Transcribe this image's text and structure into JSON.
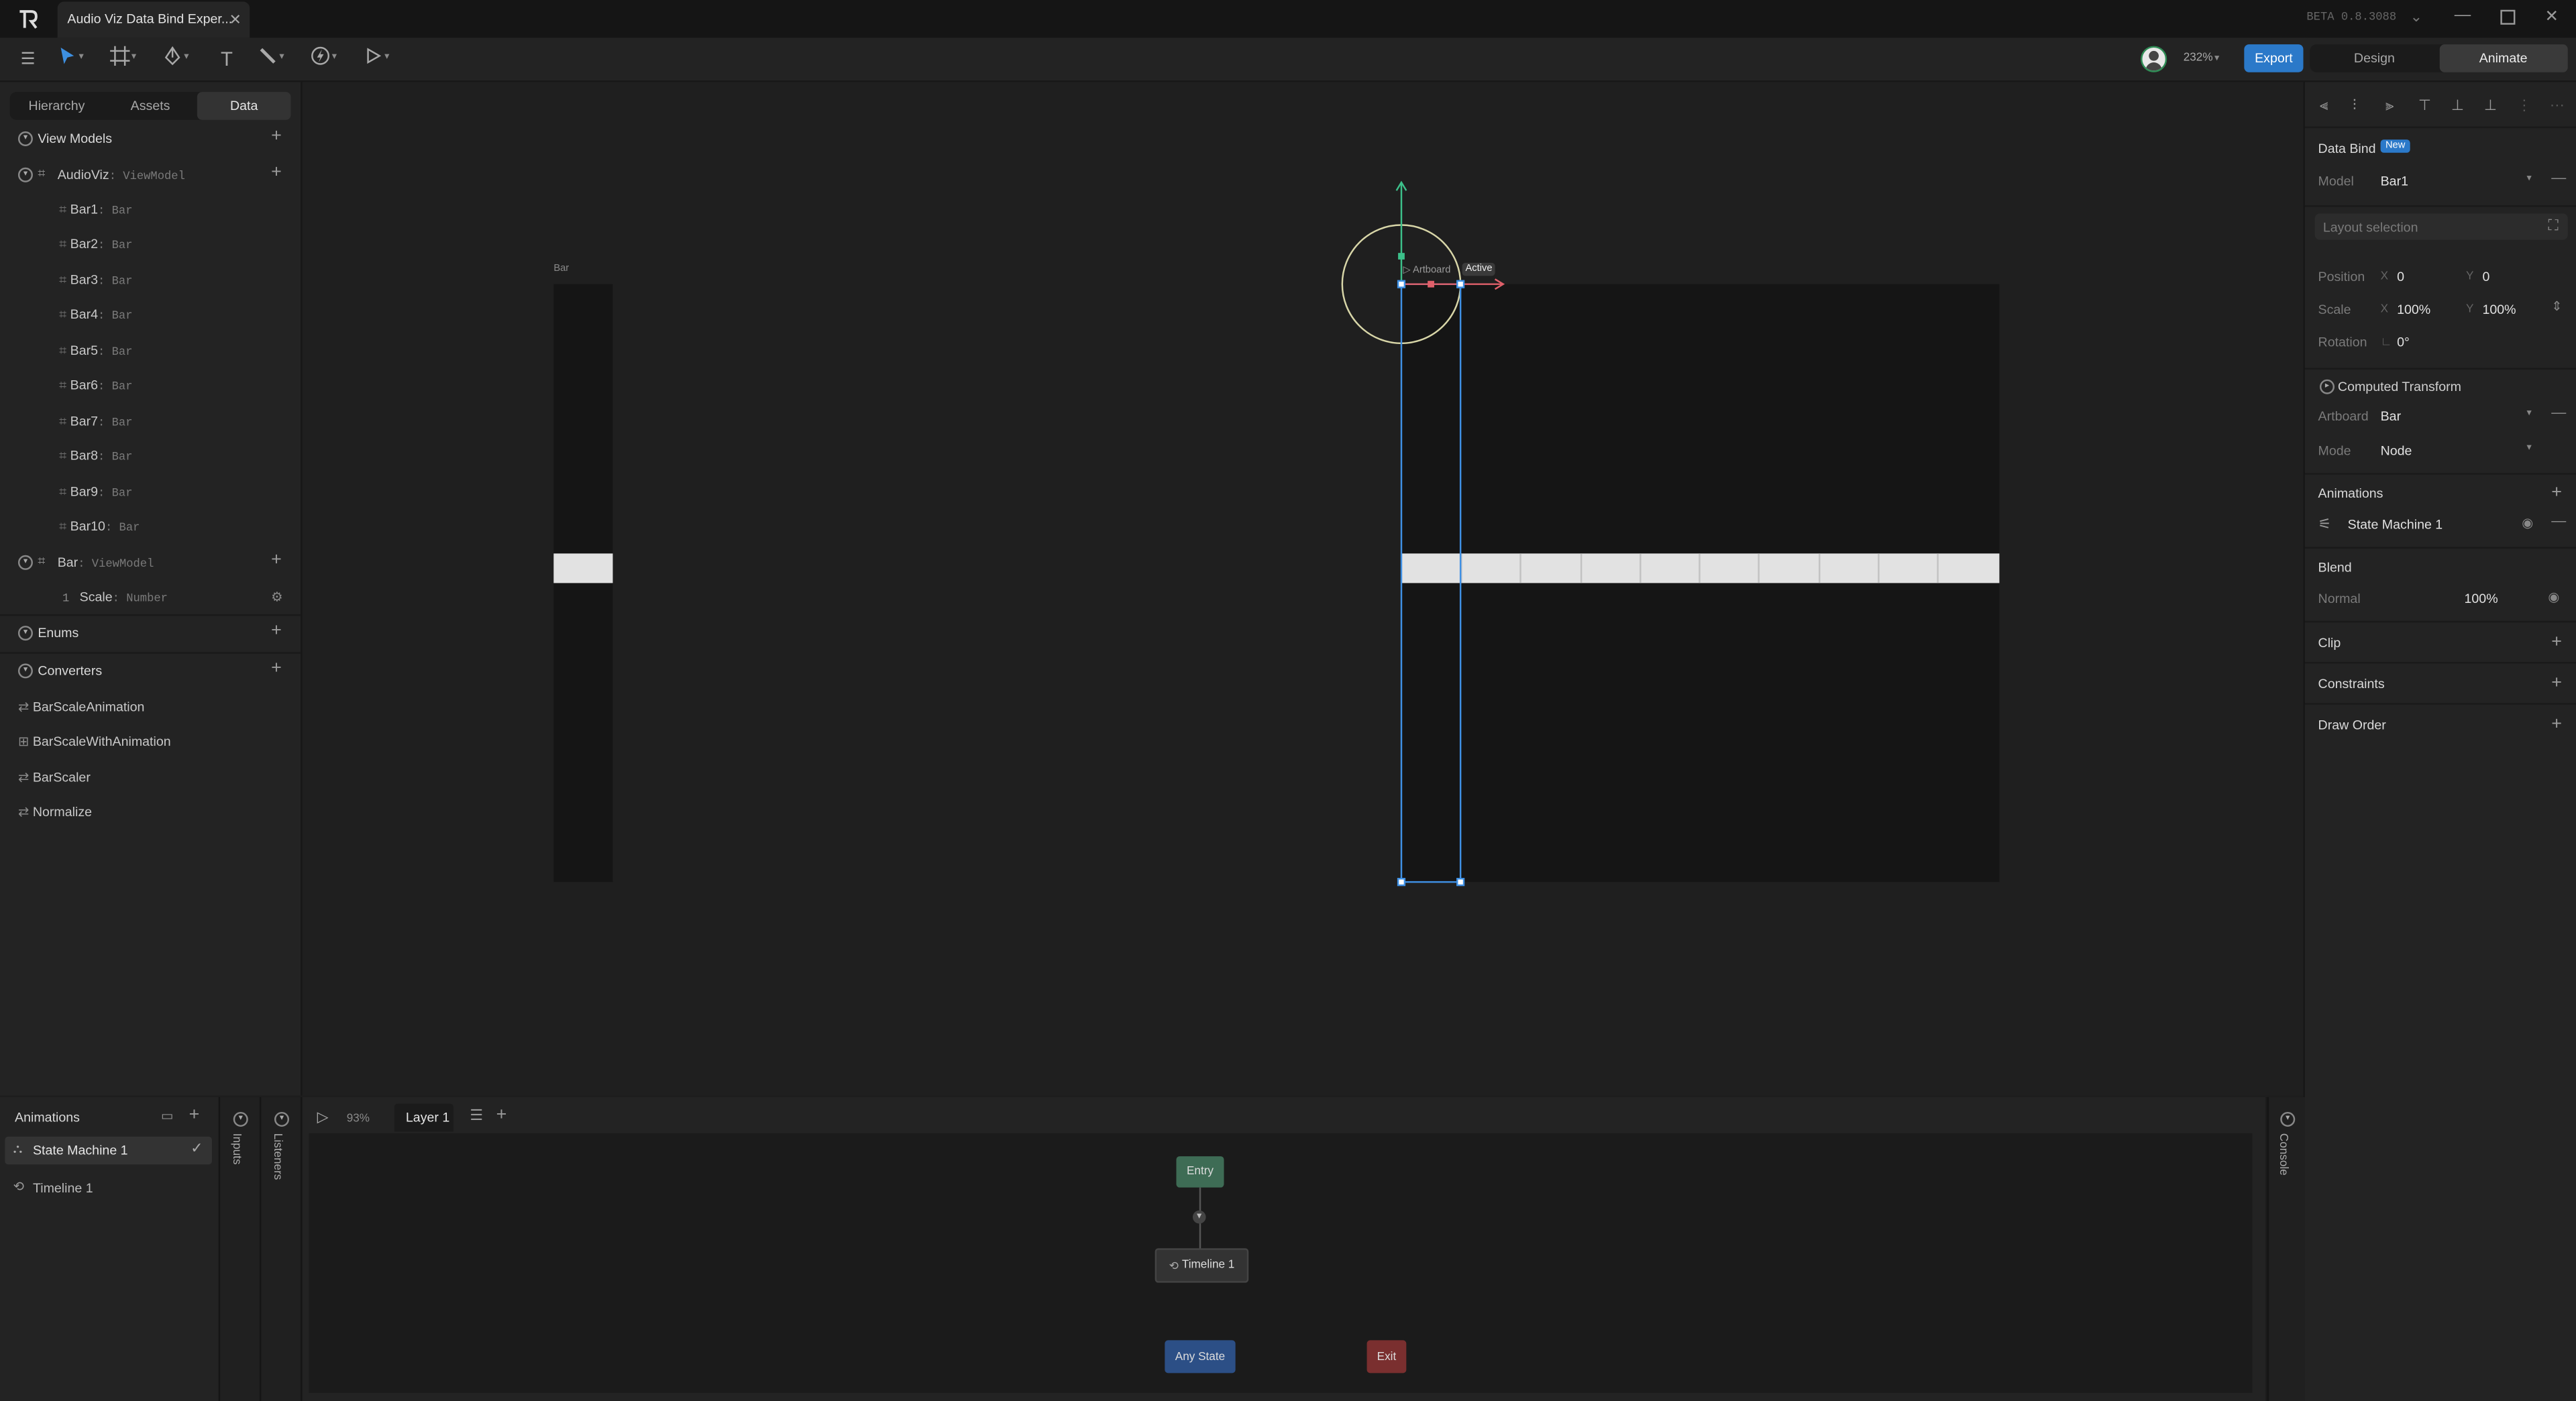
{
  "window": {
    "tab_title": "Audio Viz Data Bind Exper...",
    "version": "BETA 0.8.3088"
  },
  "toolbar": {
    "zoom": "232%",
    "export_label": "Export",
    "modes": [
      "Design",
      "Animate"
    ],
    "active_mode": "Animate"
  },
  "left_panel": {
    "tabs": [
      "Hierarchy",
      "Assets",
      "Data"
    ],
    "active_tab": "Data",
    "view_models_title": "View Models",
    "audioviz": {
      "name": "AudioViz",
      "type": ": ViewModel"
    },
    "bars": [
      {
        "name": "Bar1",
        "type": ": Bar"
      },
      {
        "name": "Bar2",
        "type": ": Bar"
      },
      {
        "name": "Bar3",
        "type": ": Bar"
      },
      {
        "name": "Bar4",
        "type": ": Bar"
      },
      {
        "name": "Bar5",
        "type": ": Bar"
      },
      {
        "name": "Bar6",
        "type": ": Bar"
      },
      {
        "name": "Bar7",
        "type": ": Bar"
      },
      {
        "name": "Bar8",
        "type": ": Bar"
      },
      {
        "name": "Bar9",
        "type": ": Bar"
      },
      {
        "name": "Bar10",
        "type": ": Bar"
      }
    ],
    "bar_vm": {
      "name": "Bar",
      "type": ": ViewModel"
    },
    "scale_prop": {
      "name": "Scale",
      "type": ": Number",
      "prefix": "1"
    },
    "enums_title": "Enums",
    "converters_title": "Converters",
    "converters": [
      "BarScaleAnimation",
      "BarScaleWithAnimation",
      "BarScaler",
      "Normalize"
    ]
  },
  "canvas": {
    "artboard_label": "Bar",
    "selection_label": "Artboard",
    "active_badge": "Active"
  },
  "right_panel": {
    "data_bind_title": "Data Bind",
    "new_badge": "New",
    "model_label": "Model",
    "model_value": "Bar1",
    "layout_selection": "Layout selection",
    "position_label": "Position",
    "pos_x": "0",
    "pos_y": "0",
    "scale_label": "Scale",
    "scale_x": "100%",
    "scale_y": "100%",
    "rotation_label": "Rotation",
    "rotation_value": "0°",
    "computed_transform": "Computed Transform",
    "artboard_label": "Artboard",
    "artboard_value": "Bar",
    "mode_label": "Mode",
    "mode_value": "Node",
    "animations_title": "Animations",
    "state_machine": "State Machine 1",
    "blend_title": "Blend",
    "blend_mode": "Normal",
    "blend_value": "100%",
    "clip_title": "Clip",
    "constraints_title": "Constraints",
    "draw_order_title": "Draw Order",
    "x_label": "X",
    "y_label": "Y"
  },
  "bottom": {
    "animations_title": "Animations",
    "items": [
      "State Machine 1",
      "Timeline 1"
    ],
    "inputs_label": "Inputs",
    "listeners_label": "Listeners",
    "speed": "93%",
    "layer_tab": "Layer 1",
    "console_label": "Console",
    "nodes": {
      "entry": "Entry",
      "timeline": "Timeline 1",
      "any_state": "Any State",
      "exit": "Exit"
    }
  },
  "colors": {
    "accent_blue": "#2b79c9",
    "entry_green": "#3e6c55",
    "any_state_blue": "#2c4f86",
    "exit_red": "#7a2f2f"
  }
}
